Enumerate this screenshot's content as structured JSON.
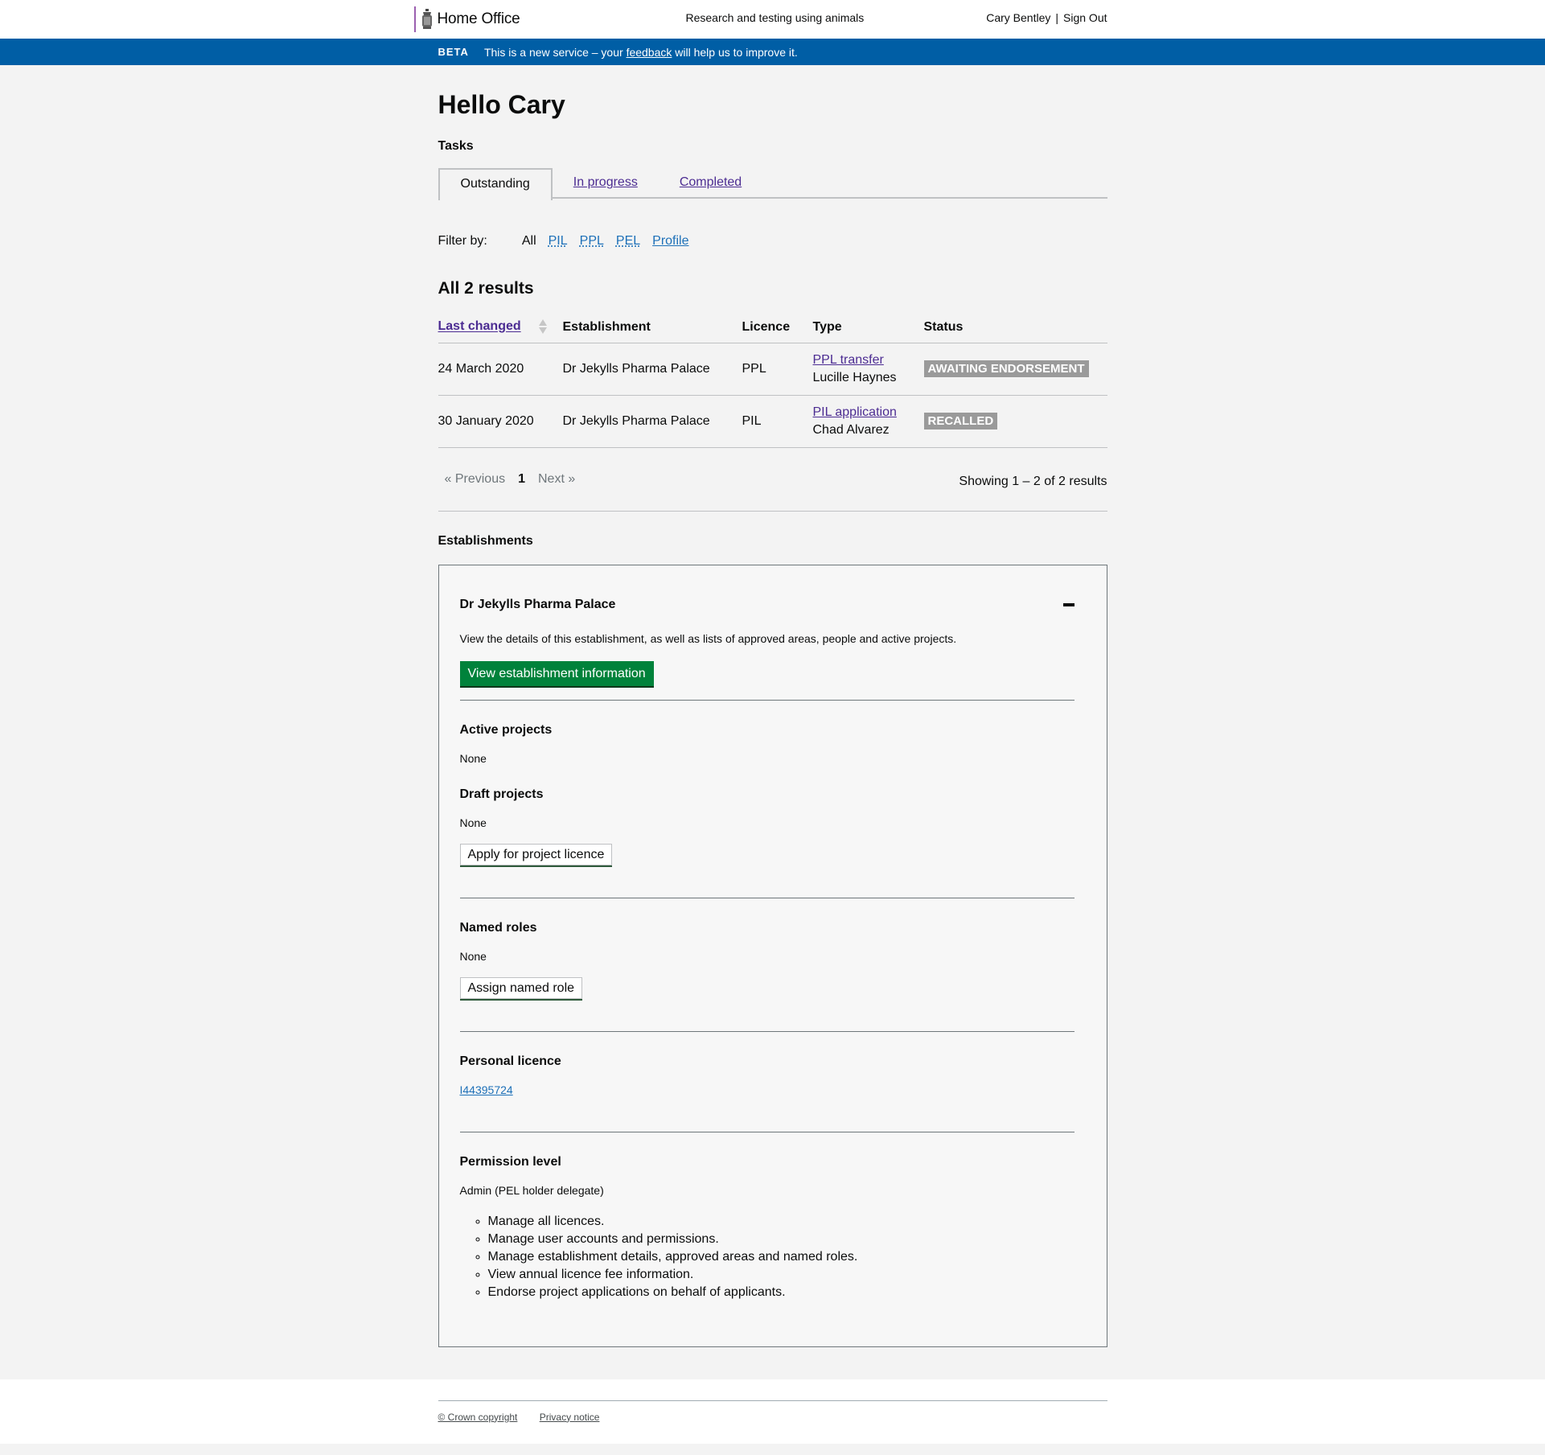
{
  "header": {
    "logo_text": "Home Office",
    "service_name": "Research and testing using animals",
    "user_name": "Cary Bentley",
    "separator": "|",
    "sign_out": "Sign Out"
  },
  "beta": {
    "tag": "BETA",
    "text_before": "This is a new service – your ",
    "link": "feedback",
    "text_after": " will help us to improve it."
  },
  "page": {
    "title": "Hello Cary",
    "tasks_heading": "Tasks"
  },
  "tabs": [
    {
      "label": "Outstanding",
      "active": true
    },
    {
      "label": "In progress",
      "active": false
    },
    {
      "label": "Completed",
      "active": false
    }
  ],
  "filter": {
    "label": "Filter by:",
    "options": [
      "All",
      "PIL",
      "PPL",
      "PEL",
      "Profile"
    ],
    "selected": "All"
  },
  "results": {
    "heading": "All 2 results",
    "columns": [
      "Last changed",
      "Establishment",
      "Licence",
      "Type",
      "Status"
    ],
    "rows": [
      {
        "last_changed": "24 March 2020",
        "establishment": "Dr Jekylls Pharma Palace",
        "licence": "PPL",
        "type_link": "PPL transfer",
        "type_person": "Lucille Haynes",
        "status": "AWAITING ENDORSEMENT"
      },
      {
        "last_changed": "30 January 2020",
        "establishment": "Dr Jekylls Pharma Palace",
        "licence": "PIL",
        "type_link": "PIL application",
        "type_person": "Chad Alvarez",
        "status": "RECALLED"
      }
    ]
  },
  "pagination": {
    "previous": "« Previous",
    "current": "1",
    "next": "Next »",
    "summary": "Showing 1 – 2 of 2 results"
  },
  "establishments": {
    "heading": "Establishments",
    "panel": {
      "name": "Dr Jekylls Pharma Palace",
      "description": "View the details of this establishment, as well as lists of approved areas, people and active projects.",
      "view_button": "View establishment information",
      "active_projects": {
        "heading": "Active projects",
        "value": "None"
      },
      "draft_projects": {
        "heading": "Draft projects",
        "value": "None",
        "button": "Apply for project licence"
      },
      "named_roles": {
        "heading": "Named roles",
        "value": "None",
        "button": "Assign named role"
      },
      "personal_licence": {
        "heading": "Personal licence",
        "number": "I44395724"
      },
      "permission_level": {
        "heading": "Permission level",
        "value": "Admin (PEL holder delegate)",
        "items": [
          "Manage all licences.",
          "Manage user accounts and permissions.",
          "Manage establishment details, approved areas and named roles.",
          "View annual licence fee information.",
          "Endorse project applications on behalf of applicants."
        ]
      }
    }
  },
  "footer": {
    "copyright": "© Crown copyright",
    "privacy": "Privacy notice"
  },
  "colors": {
    "beta_banner": "#005ea5",
    "primary_button": "#00823b",
    "visited_link": "#4c2c92",
    "link": "#1d70b8",
    "badge_grey": "#9a9a9a"
  }
}
